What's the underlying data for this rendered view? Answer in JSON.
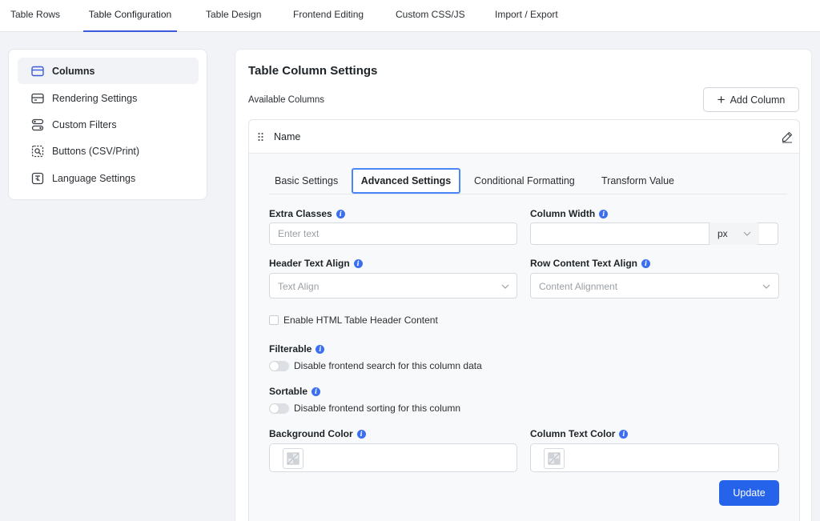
{
  "topnav": {
    "tabs": [
      {
        "label": "Table Rows"
      },
      {
        "label": "Table Configuration",
        "active": true
      },
      {
        "label": "Table Design"
      },
      {
        "label": "Frontend Editing"
      },
      {
        "label": "Custom CSS/JS"
      },
      {
        "label": "Import / Export"
      }
    ]
  },
  "sidebar": {
    "items": [
      {
        "label": "Columns",
        "icon": "columns-icon",
        "active": true
      },
      {
        "label": "Rendering Settings",
        "icon": "rendering-icon"
      },
      {
        "label": "Custom Filters",
        "icon": "filters-icon"
      },
      {
        "label": "Buttons (CSV/Print)",
        "icon": "buttons-icon"
      },
      {
        "label": "Language Settings",
        "icon": "language-icon"
      }
    ]
  },
  "main": {
    "title": "Table Column Settings",
    "available_label": "Available Columns",
    "add_column_label": "Add Column",
    "column": {
      "name": "Name",
      "settings_tabs": [
        {
          "label": "Basic Settings"
        },
        {
          "label": "Advanced Settings",
          "active": true
        },
        {
          "label": "Conditional Formatting"
        },
        {
          "label": "Transform Value"
        }
      ],
      "form": {
        "extra_classes": {
          "label": "Extra Classes",
          "placeholder": "Enter text",
          "value": ""
        },
        "column_width": {
          "label": "Column Width",
          "value": "",
          "unit": "px"
        },
        "header_text_align": {
          "label": "Header Text Align",
          "placeholder": "Text Align"
        },
        "row_content_text_align": {
          "label": "Row Content Text Align",
          "placeholder": "Content Alignment"
        },
        "html_header": {
          "label": "Enable HTML Table Header Content",
          "checked": false
        },
        "filterable": {
          "label": "Filterable",
          "toggle_label": "Disable frontend search for this column data",
          "on": false
        },
        "sortable": {
          "label": "Sortable",
          "toggle_label": "Disable frontend sorting for this column",
          "on": false
        },
        "background_color": {
          "label": "Background Color"
        },
        "column_text_color": {
          "label": "Column Text Color"
        }
      },
      "update_label": "Update"
    }
  },
  "colors": {
    "accent": "#2563eb",
    "active_tab_border": "#4a86f7",
    "info_icon": "#3b6ff0",
    "page_bg": "#f1f3f7"
  }
}
